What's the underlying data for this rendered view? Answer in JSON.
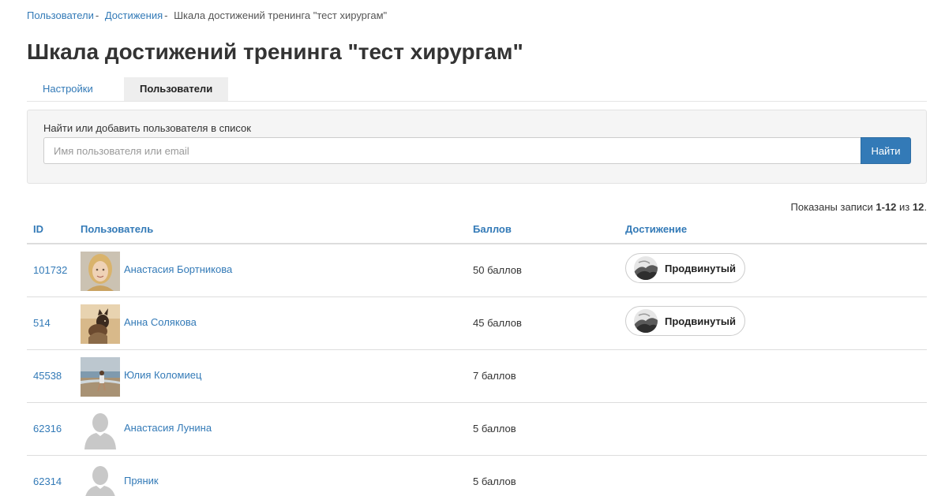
{
  "breadcrumb": {
    "items": [
      "Пользователи",
      "Достижения"
    ],
    "separator": "-",
    "current": "Шкала достижений тренинга \"тест хирургам\""
  },
  "page_title": "Шкала достижений тренинга \"тест хирургам\"",
  "tabs": [
    {
      "label": "Настройки",
      "active": false
    },
    {
      "label": "Пользователи",
      "active": true
    }
  ],
  "search": {
    "label": "Найти или добавить пользователя в список",
    "placeholder": "Имя пользователя или email",
    "value": "",
    "button_label": "Найти"
  },
  "records": {
    "prefix": "Показаны записи",
    "range": "1-12",
    "of": "из",
    "total": "12",
    "suffix": "."
  },
  "table": {
    "headers": {
      "id": "ID",
      "user": "Пользователь",
      "score": "Баллов",
      "achievement": "Достижение"
    },
    "rows": [
      {
        "id": "101732",
        "name": "Анастасия Бортникова",
        "avatar": "photo-woman-icon",
        "score": "50 баллов",
        "achievement": "Продвинутый"
      },
      {
        "id": "514",
        "name": "Анна Солякова",
        "avatar": "photo-dog-icon",
        "score": "45 баллов",
        "achievement": "Продвинутый"
      },
      {
        "id": "45538",
        "name": "Юлия Коломиец",
        "avatar": "photo-beach-icon",
        "score": "7 баллов",
        "achievement": ""
      },
      {
        "id": "62316",
        "name": "Анастасия Лунина",
        "avatar": "default-user-icon",
        "score": "5 баллов",
        "achievement": ""
      },
      {
        "id": "62314",
        "name": "Пряник",
        "avatar": "default-user-icon",
        "score": "5 баллов",
        "achievement": ""
      }
    ]
  },
  "colors": {
    "link": "#337ab7",
    "button": "#337ab7",
    "panel_bg": "#f5f5f5",
    "active_tab_bg": "#eeeeee"
  }
}
